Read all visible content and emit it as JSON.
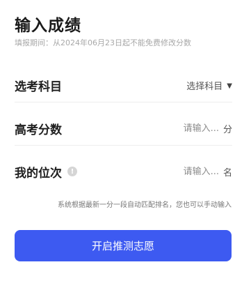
{
  "header": {
    "title": "输入成绩",
    "subtitle": "填报期间：从2024年06月23日起不能免费修改分数"
  },
  "form": {
    "subject": {
      "label": "选考科目",
      "value": "选择科目"
    },
    "score": {
      "label": "高考分数",
      "placeholder": "请输入...",
      "unit": "分"
    },
    "rank": {
      "label": "我的位次",
      "info_icon_glyph": "!",
      "placeholder": "请输入...",
      "unit": "名"
    }
  },
  "hint": "系统根据最新一分一段自动匹配排名，您也可以手动输入",
  "submit_label": "开启推测志愿",
  "colors": {
    "accent": "#3d5af1"
  }
}
